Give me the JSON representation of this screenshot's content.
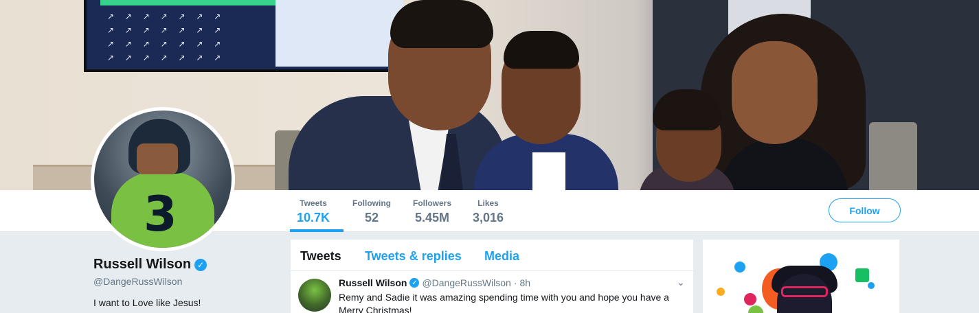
{
  "profile": {
    "name": "Russell Wilson",
    "handle": "@DangeRussWilson",
    "bio": "I want to Love like Jesus!",
    "verified_glyph": "✓"
  },
  "stats": [
    {
      "label": "Tweets",
      "value": "10.7K",
      "active": true
    },
    {
      "label": "Following",
      "value": "52",
      "active": false
    },
    {
      "label": "Followers",
      "value": "5.45M",
      "active": false
    },
    {
      "label": "Likes",
      "value": "3,016",
      "active": false
    }
  ],
  "follow_button": "Follow",
  "timeline_tabs": [
    {
      "label": "Tweets",
      "active": true
    },
    {
      "label": "Tweets & replies",
      "active": false
    },
    {
      "label": "Media",
      "active": false
    }
  ],
  "tweet": {
    "author": "Russell Wilson",
    "handle": "@DangeRussWilson",
    "separator": "·",
    "time": "8h",
    "text": "Remy and Sadie it was amazing spending time with you and hope you have a Merry Christmas!",
    "menu_icon": "chevron-down-icon",
    "menu_glyph": "⌄"
  },
  "banner_tv": {
    "arrows_row1": "↗ ↗ ↗ ↗ ↗ ↗ ↗",
    "arrows_row2": "↗ ↗ ↗ ↗ ↗ ↗ ↗",
    "arrows_row3": "↗ ↗ ↗ ↗ ↗ ↗ ↗",
    "arrows_row4": "↗ ↗ ↗ ↗ ↗ ↗ ↗"
  },
  "avatar_jersey_number": "3",
  "colors": {
    "accent": "#1da1f2",
    "background": "#e6ecf0",
    "text_primary": "#14171a",
    "text_secondary": "#657786"
  }
}
